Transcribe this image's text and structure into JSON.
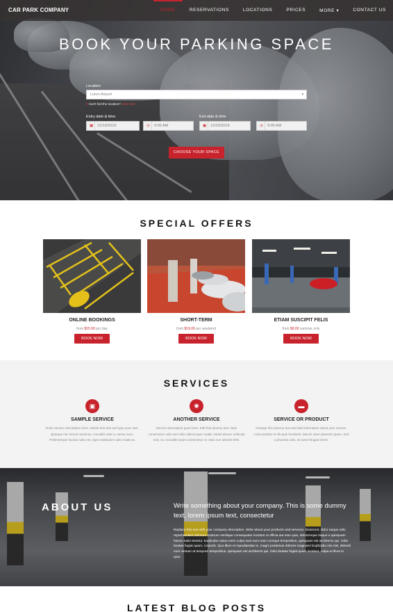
{
  "header": {
    "brand": "CAR PARK COMPANY",
    "nav": [
      "HOME",
      "RESERVATIONS",
      "LOCATIONS",
      "PRICES",
      "MORE ▾",
      "CONTACT US"
    ]
  },
  "hero": {
    "title": "BOOK YOUR PARKING SPACE",
    "location_label": "Location",
    "location_value": "Luton Airport",
    "cant_find": "Can't find the location?",
    "cant_find_link": "Click here",
    "entry_label": "Entry date & time",
    "entry_date": "12/19/2019",
    "entry_time": "9:00 AM",
    "exit_label": "Exit date & time",
    "exit_date": "12/20/2019",
    "exit_time": "9:00 AM",
    "cta": "CHOOSE YOUR SPACE"
  },
  "offers": {
    "title": "SPECIAL OFFERS",
    "items": [
      {
        "name": "ONLINE BOOKINGS",
        "prefix": "from",
        "price": "$15.00",
        "suffix": "per day",
        "button": "BOOK NOW"
      },
      {
        "name": "SHORT-TERM",
        "prefix": "from",
        "price": "$19.00",
        "suffix": "per weekend",
        "button": "BOOK NOW"
      },
      {
        "name": "ETIAM SUSCIPIT FELIS",
        "prefix": "from",
        "price": "$9.00",
        "suffix": "summer only",
        "button": "BOOK NOW"
      }
    ]
  },
  "services": {
    "title": "SERVICES",
    "items": [
      {
        "icon": "id-card-icon",
        "title": "SAMPLE SERVICE",
        "desc": "Enter service description here. Delete this text and type your own. Quisque nec lectus maximus, convallis ante a, varius nunc. Pellentesque lacinia nulla est, eget vestibulum odio mattis at."
      },
      {
        "icon": "lightbulb-icon",
        "title": "ANOTHER SERVICE",
        "desc": "Service description goes here. Edit this dummy text. Nam consectetur odio sed nulla ullamcorper mattis. Morbi dictum vehicula erat, eu convallis turpis consectetur et. Duis non lobortis felis."
      },
      {
        "icon": "money-icon",
        "title": "SERVICE OR PRODUCT",
        "desc": "Change this dummy text and add information about your service. Cras porttitor et elit quis hendrerit. Mauris vitae pharetra quam. Sed a pharetra odio, sit amet feugiat lorem."
      }
    ]
  },
  "about": {
    "title": "ABOUT US",
    "lead": "Write something about your company. This is some dummy text, lorem ipsum text, consectetur",
    "body": "Replace this text with your company description. Write about your products and services. Deserunt, dolor eaque odio reprehenderit dolorum nostrum similique consequatur incidunt ut officia aut eius quia, doloremque itaque a quisquam harum iusto tenetur. Explicabo natus enim culpa sunt eum nam cumque temporibus, quisquam est architecto qui. Odio beatae fugiat quam, corporis. Quo illum et repudiandae in, magni possimus dolores magnam! Explicabo nisi nisi, deleniti cum veniam at tempore temporibus, quisquam est architecto qui. Odio beatae fugiat quam incidunt, culpa et illum in quia."
  },
  "blog": {
    "title": "LATEST BLOG POSTS"
  }
}
